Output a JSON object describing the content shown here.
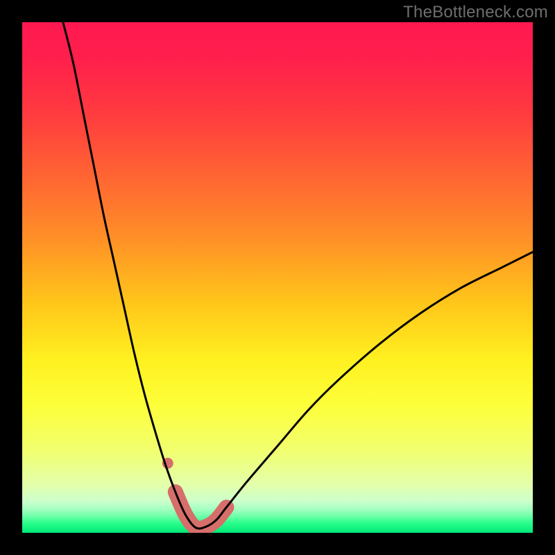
{
  "watermark": "TheBottleneck.com",
  "colors": {
    "frame": "#000000",
    "gradient_stops": [
      {
        "offset": 0.0,
        "color": "#ff1850"
      },
      {
        "offset": 0.07,
        "color": "#ff1f4c"
      },
      {
        "offset": 0.18,
        "color": "#ff3b3f"
      },
      {
        "offset": 0.3,
        "color": "#ff6433"
      },
      {
        "offset": 0.42,
        "color": "#ff8e27"
      },
      {
        "offset": 0.55,
        "color": "#ffc61a"
      },
      {
        "offset": 0.66,
        "color": "#fff020"
      },
      {
        "offset": 0.75,
        "color": "#fdff3a"
      },
      {
        "offset": 0.84,
        "color": "#f1ff70"
      },
      {
        "offset": 0.905,
        "color": "#e3ffaa"
      },
      {
        "offset": 0.938,
        "color": "#ccffcc"
      },
      {
        "offset": 0.955,
        "color": "#a0ffbf"
      },
      {
        "offset": 0.968,
        "color": "#6cffa8"
      },
      {
        "offset": 0.98,
        "color": "#2dff8c"
      },
      {
        "offset": 1.0,
        "color": "#00e878"
      }
    ],
    "curve": "#000000",
    "marker": "#d66e6a"
  },
  "chart_data": {
    "type": "line",
    "title": "",
    "xlabel": "",
    "ylabel": "",
    "xlim": [
      0,
      100
    ],
    "ylim": [
      0,
      100
    ],
    "grid": false,
    "note": "Bottleneck-percentage style curve. Minimum (~0%) near x≈34; rises steeply toward 100 at small x and toward ~55 at x=100. Axis values are estimated from pixel positions; no tick labels are shown.",
    "series": [
      {
        "name": "bottleneck-curve",
        "x": [
          8,
          10,
          12,
          14,
          16,
          18,
          20,
          22,
          24,
          26,
          28,
          30,
          32,
          34,
          36,
          38,
          40,
          44,
          50,
          56,
          62,
          70,
          78,
          86,
          94,
          100
        ],
        "y": [
          100,
          92,
          82,
          72,
          62,
          53,
          44,
          35,
          27,
          20,
          13.5,
          8,
          3.5,
          1,
          1.2,
          2.5,
          5,
          10,
          17,
          24,
          30,
          37,
          43,
          48,
          52,
          55
        ]
      }
    ],
    "markers": [
      {
        "name": "valley-highlight",
        "shape": "rounded-band",
        "x_range": [
          29,
          41
        ],
        "y_range": [
          0,
          10
        ]
      }
    ]
  }
}
